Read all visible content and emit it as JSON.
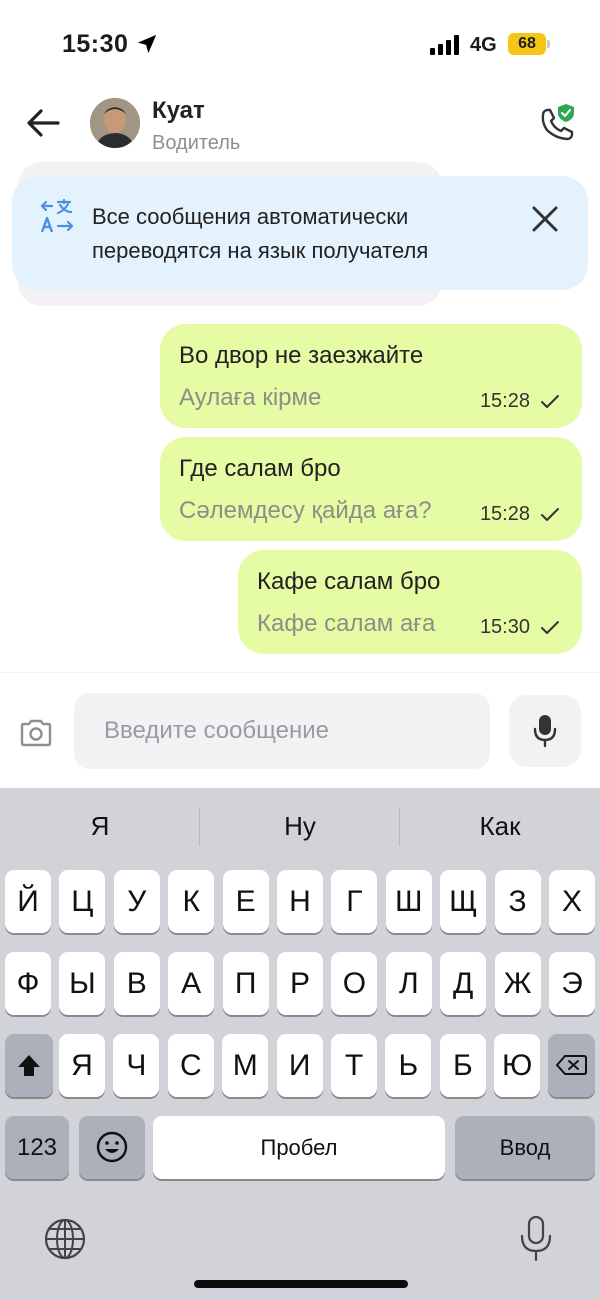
{
  "status_bar": {
    "time": "15:30",
    "network": "4G",
    "battery": "68",
    "battery_color": "#f5c518"
  },
  "header": {
    "contact_name": "Куат",
    "contact_role": "Водитель",
    "back_icon": "arrow-left-icon",
    "call_icon": "phone-shield-icon"
  },
  "banner": {
    "text": "Все сообщения автоматически переводятся на язык получателя",
    "icon": "translate-icon",
    "close_icon": "close-icon",
    "background": "#e4f2fd"
  },
  "messages": [
    {
      "text": "Во двор не заезжайте",
      "translation": "Аулаға кірме",
      "time": "15:28",
      "status": "sent"
    },
    {
      "text": "Где салам бро",
      "translation": "Сәлемдесу қайда аға?",
      "time": "15:28",
      "status": "sent"
    },
    {
      "text": "Кафе салам бро",
      "translation": "Кафе салам аға",
      "time": "15:30",
      "status": "sent"
    }
  ],
  "bubble_color": "#e5fca5",
  "input": {
    "placeholder": "Введите сообщение",
    "value": ""
  },
  "keyboard": {
    "suggestions": [
      "Я",
      "Ну",
      "Как"
    ],
    "row1": [
      "Й",
      "Ц",
      "У",
      "К",
      "Е",
      "Н",
      "Г",
      "Ш",
      "Щ",
      "З",
      "Х"
    ],
    "row2": [
      "Ф",
      "Ы",
      "В",
      "А",
      "П",
      "Р",
      "О",
      "Л",
      "Д",
      "Ж",
      "Э"
    ],
    "row3": [
      "Я",
      "Ч",
      "С",
      "М",
      "И",
      "Т",
      "Ь",
      "Б",
      "Ю"
    ],
    "numbers_label": "123",
    "space_label": "Пробел",
    "return_label": "Ввод"
  }
}
